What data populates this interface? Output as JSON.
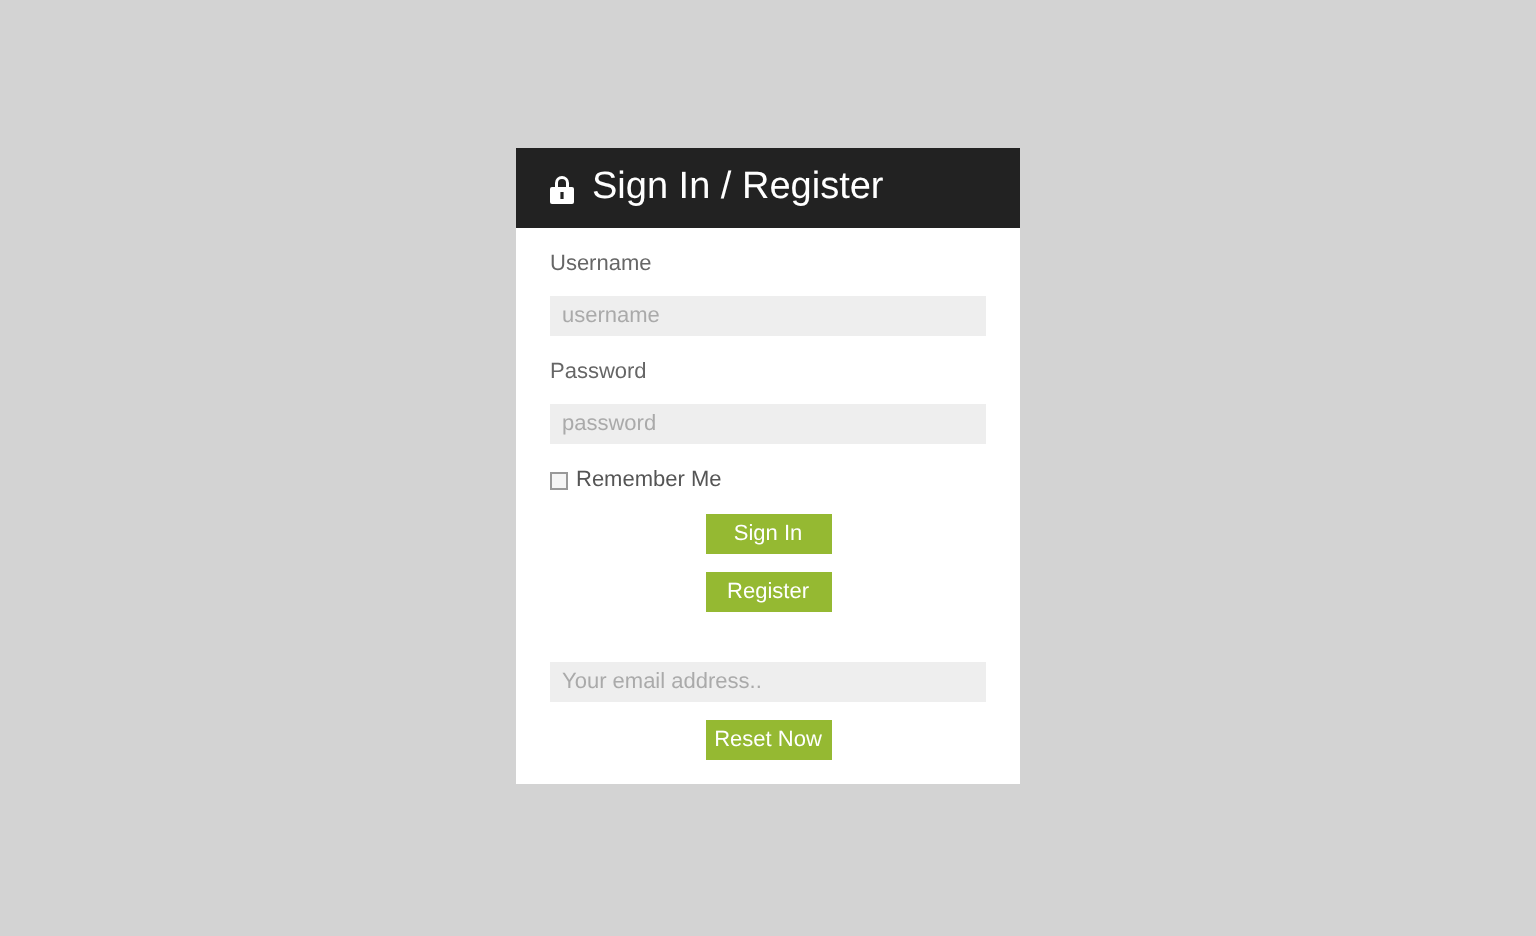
{
  "title": "Sign In / Register",
  "username": {
    "label": "Username",
    "placeholder": "username"
  },
  "password": {
    "label": "Password",
    "placeholder": "password"
  },
  "remember": {
    "label": "Remember Me",
    "checked": false
  },
  "buttons": [
    "Sign In",
    "Register"
  ],
  "reset": {
    "placeholder": "Your email address..",
    "button": "Reset Now"
  }
}
